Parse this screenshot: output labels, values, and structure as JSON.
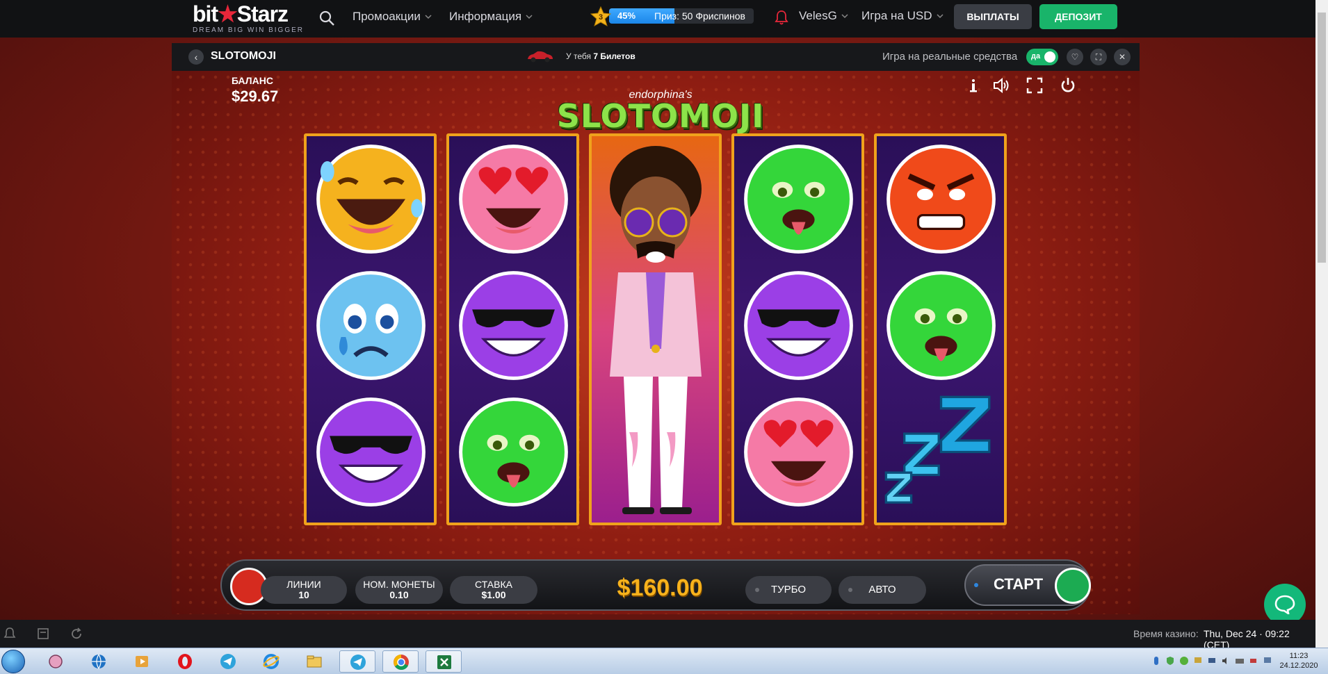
{
  "site": {
    "logo_text": "bit★Starz",
    "logo_main_a": "bit",
    "logo_main_b": "Starz",
    "logo_tagline": "DREAM BIG  WIN BIGGER",
    "nav": [
      {
        "label": "Промоакции"
      },
      {
        "label": "Информация"
      }
    ],
    "level": "3",
    "progress_pct_label": "45%",
    "progress_value": 0.45,
    "prize_text": "Приз: 50 Фриспинов",
    "username": "VelesG",
    "currency": "Игра на USD",
    "payout_button": "ВЫПЛАТЫ",
    "deposit_button": "ДЕПОЗИТ",
    "colors": {
      "accent_green": "#19b46a",
      "progress_blue": "#1b86e8"
    }
  },
  "game_header": {
    "title": "SLOTOMOJI",
    "tickets_prefix": "У тебя",
    "tickets_count": "7 Билетов",
    "real_money_label": "Игра на реальные средства",
    "toggle_label": "да",
    "icons": [
      "heart-icon",
      "fullscreen-icon",
      "close-icon"
    ]
  },
  "game": {
    "balance_label": "БАЛАНС",
    "balance_value": "$29.67",
    "brand_small": "endorphina's",
    "brand_big": "SLOTOMOJI",
    "reels": [
      [
        "laughing-emoji",
        "crying-blue-emoji",
        "sunglasses-emoji"
      ],
      [
        "heart-eyes-emoji",
        "sunglasses-emoji",
        "sick-green-emoji"
      ],
      [
        "wild-disco-character"
      ],
      [
        "sick-green-emoji",
        "sunglasses-emoji",
        "heart-eyes-emoji"
      ],
      [
        "angry-emoji",
        "sick-green-emoji",
        "sleep-zzz-symbol"
      ]
    ],
    "controls": {
      "lines_label": "ЛИНИИ",
      "lines_value": "10",
      "coin_label": "НОМ. МОНЕТЫ",
      "coin_value": "0.10",
      "bet_label": "СТАВКА",
      "bet_value": "$1.00",
      "total_bet": "$160.00",
      "turbo_label": "ТУРБО",
      "auto_label": "АВТО",
      "start_label": "СТАРТ"
    }
  },
  "bottom_bar": {
    "casino_time_label": "Время казино:",
    "casino_time_value": "Thu, Dec 24 · 09:22 (CET)"
  },
  "taskbar": {
    "clock_time": "11:23",
    "clock_date": "24.12.2020",
    "apps": [
      "paint-app",
      "globe-app",
      "media-player-app",
      "opera-app",
      "telegram-app",
      "ie-app",
      "explorer-app",
      "telegram-app-2",
      "chrome-app",
      "excel-app"
    ]
  }
}
